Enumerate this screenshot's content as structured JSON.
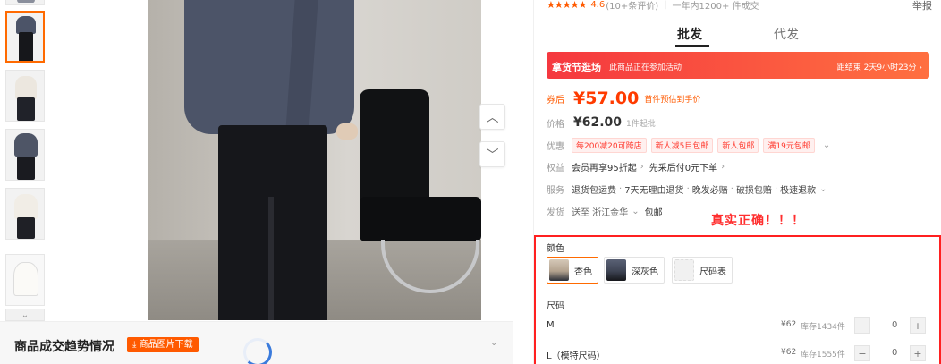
{
  "gallery": {
    "thumbnails": [
      "thumb-1",
      "thumb-2",
      "thumb-3",
      "thumb-4",
      "thumb-5",
      "thumb-6",
      "thumb-7"
    ]
  },
  "trend": {
    "title": "商品成交趋势情况",
    "download_label": "商品图片下载"
  },
  "product": {
    "rating_stars": "★★★★★",
    "rating_score": "4.6",
    "review_count": "(10+条评价)",
    "sold_text": "一年内1200+ 件成交",
    "report": "举报"
  },
  "tabs": [
    {
      "label": "批发",
      "active": true
    },
    {
      "label": "代发",
      "active": false
    }
  ],
  "promo": {
    "tag": "拿货节逛场",
    "text": "此商品正在参加活动",
    "countdown": "距结束 2天9小时23分 ›"
  },
  "pricing": {
    "coupon_label": "券后",
    "coupon_price": "¥57.00",
    "coupon_note": "首件预估到手价",
    "price_label": "价格",
    "price": "¥62.00",
    "moq": "1件起批",
    "discount_label": "优惠",
    "coupons": [
      "每200减20可跨店",
      "新人减5目包邮",
      "新人包邮",
      "满19元包邮"
    ]
  },
  "rights": {
    "label": "权益",
    "items": [
      "会员再享95折起",
      "先采后付0元下单"
    ]
  },
  "service": {
    "label": "服务",
    "items": [
      "退货包运费",
      "7天无理由退货",
      "晚发必赔",
      "破损包赔",
      "极速退款"
    ]
  },
  "shipping": {
    "label": "发货",
    "destination": "送至 浙江金华",
    "free": "包邮"
  },
  "annotation": "真实正确！！！",
  "specs": {
    "color_title": "颜色",
    "colors": [
      {
        "label": "杏色",
        "active": true,
        "swatch": "#c9b9a6"
      },
      {
        "label": "深灰色",
        "active": false,
        "swatch": "#3e4454"
      },
      {
        "label": "尺码表",
        "active": false,
        "swatch": "#efefef"
      }
    ],
    "size_title": "尺码",
    "sizes": [
      {
        "name": "M",
        "price": "¥62",
        "stock": "库存1434件",
        "qty": "0"
      },
      {
        "name": "L（模特尺码）",
        "price": "¥62",
        "stock": "库存1555件",
        "qty": "0"
      }
    ]
  },
  "colors": {
    "accent": "#ff5a00",
    "highlight_border": "#ff2020",
    "promo_start": "#f5383f",
    "promo_end": "#ff7040"
  }
}
